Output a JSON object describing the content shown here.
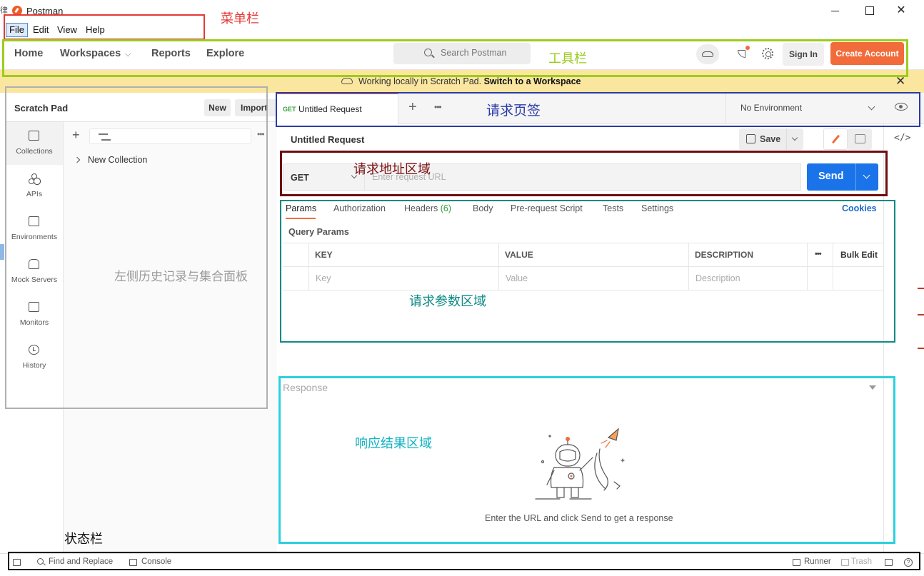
{
  "window": {
    "app_title": "Postman",
    "left_clip_text": "律"
  },
  "menubar": {
    "items": [
      "File",
      "Edit",
      "View",
      "Help"
    ]
  },
  "toolbar": {
    "nav": [
      "Home",
      "Workspaces",
      "Reports",
      "Explore"
    ],
    "search_placeholder": "Search Postman",
    "sign_in": "Sign In",
    "create_account": "Create Account"
  },
  "banner": {
    "text": "Working locally in Scratch Pad.",
    "link": "Switch to a Workspace"
  },
  "sidebar": {
    "title": "Scratch Pad",
    "new_label": "New",
    "import_label": "Import",
    "rail": [
      {
        "label": "Collections",
        "icon": "collections-icon"
      },
      {
        "label": "APIs",
        "icon": "apis-icon"
      },
      {
        "label": "Environments",
        "icon": "environments-icon"
      },
      {
        "label": "Mock Servers",
        "icon": "mock-servers-icon"
      },
      {
        "label": "Monitors",
        "icon": "monitors-icon"
      },
      {
        "label": "History",
        "icon": "history-icon"
      }
    ],
    "collections": [
      "New Collection"
    ]
  },
  "tabs": {
    "active": {
      "method": "GET",
      "name": "Untitled Request"
    },
    "environment": "No Environment"
  },
  "request": {
    "title": "Untitled Request",
    "save_label": "Save",
    "method": "GET",
    "url_placeholder": "Enter request URL",
    "send_label": "Send",
    "param_tabs": [
      {
        "label": "Params"
      },
      {
        "label": "Authorization"
      },
      {
        "label": "Headers",
        "count": "(6)"
      },
      {
        "label": "Body"
      },
      {
        "label": "Pre-request Script"
      },
      {
        "label": "Tests"
      },
      {
        "label": "Settings"
      }
    ],
    "cookies_label": "Cookies",
    "query_params_title": "Query Params",
    "table": {
      "headers": [
        "KEY",
        "VALUE",
        "DESCRIPTION"
      ],
      "placeholders": [
        "Key",
        "Value",
        "Description"
      ],
      "bulk_edit": "Bulk Edit"
    }
  },
  "response": {
    "label": "Response",
    "hint": "Enter the URL and click Send to get a response"
  },
  "statusbar": {
    "find_replace": "Find and Replace",
    "console": "Console",
    "runner": "Runner",
    "trash": "Trash",
    "help": "?"
  },
  "annotations": {
    "menubar": "菜单栏",
    "toolbar": "工具栏",
    "sidebar": "左侧历史记录与集合面板",
    "tabs": "请求页签",
    "url": "请求地址区域",
    "params": "请求参数区域",
    "response": "响应结果区域",
    "statusbar": "状态栏"
  },
  "colors": {
    "accent_orange": "#f26b3a",
    "send_blue": "#1a73e8",
    "banner_yellow": "#fbe6a0",
    "anno_menubar": "#e53935",
    "anno_toolbar": "#9ccc1c",
    "anno_sidebar": "#b0b0b0",
    "anno_tabs": "#2a3ba6",
    "anno_url": "#6d0e0e",
    "anno_params": "#0f8a84",
    "anno_response": "#2bd0dc",
    "anno_statusbar": "#111111"
  }
}
